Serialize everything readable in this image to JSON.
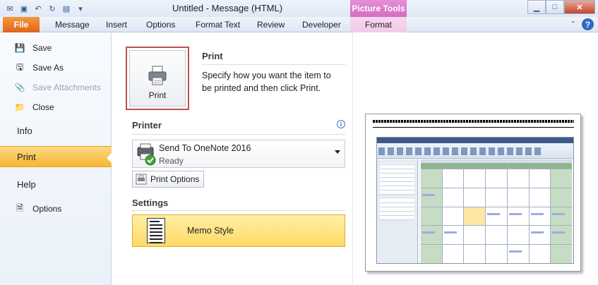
{
  "window": {
    "title": "Untitled  -  Message (HTML)",
    "context_tab_group": "Picture Tools"
  },
  "ribbon": {
    "file_label": "File",
    "tabs": [
      "Message",
      "Insert",
      "Options",
      "Format Text",
      "Review",
      "Developer"
    ],
    "context_tab": "Format"
  },
  "menu": {
    "save": "Save",
    "save_as": "Save As",
    "save_attachments": "Save Attachments",
    "close": "Close",
    "info": "Info",
    "print": "Print",
    "help": "Help",
    "options": "Options"
  },
  "print_panel": {
    "button_label": "Print",
    "section_title": "Print",
    "description": "Specify how you want the item to be printed and then click Print."
  },
  "printer": {
    "section_title": "Printer",
    "name": "Send To OneNote 2016",
    "status": "Ready",
    "options_button": "Print Options"
  },
  "settings": {
    "section_title": "Settings",
    "style": "Memo Style"
  },
  "colors": {
    "file_tab": "#e0621a",
    "active_menu": "#f7b533",
    "context_tab": "#d56cc1",
    "print_highlight": "#c0504d"
  }
}
